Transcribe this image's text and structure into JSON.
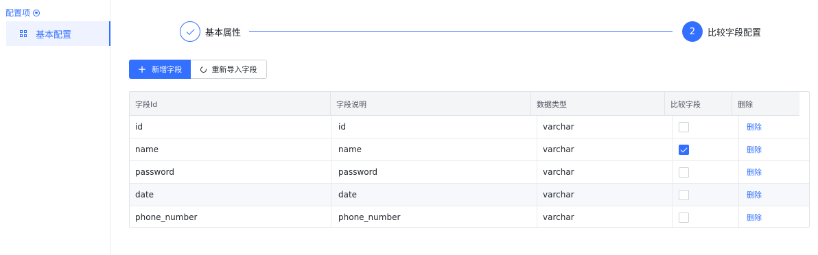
{
  "sidebar": {
    "header": "配置项",
    "items": [
      {
        "label": "基本配置",
        "icon": "grid-icon",
        "active": true
      }
    ]
  },
  "steps": [
    {
      "label": "基本属性",
      "status": "done"
    },
    {
      "number": "2",
      "label": "比较字段配置",
      "status": "active"
    }
  ],
  "toolbar": {
    "add_label": "新增字段",
    "reimport_label": "重新导入字段"
  },
  "table": {
    "columns": [
      "字段Id",
      "字段说明",
      "数据类型",
      "比较字段",
      "删除"
    ],
    "rows": [
      {
        "id": "id",
        "desc": "id",
        "type": "varchar",
        "compare": false,
        "action": "删除"
      },
      {
        "id": "name",
        "desc": "name",
        "type": "varchar",
        "compare": true,
        "action": "删除"
      },
      {
        "id": "password",
        "desc": "password",
        "type": "varchar",
        "compare": false,
        "action": "删除"
      },
      {
        "id": "date",
        "desc": "date",
        "type": "varchar",
        "compare": false,
        "action": "删除"
      },
      {
        "id": "phone_number",
        "desc": "phone_number",
        "type": "varchar",
        "compare": false,
        "action": "删除"
      }
    ]
  },
  "colors": {
    "accent": "#3370ff",
    "border": "#e1e3e6",
    "header_bg": "#f4f5f7"
  }
}
